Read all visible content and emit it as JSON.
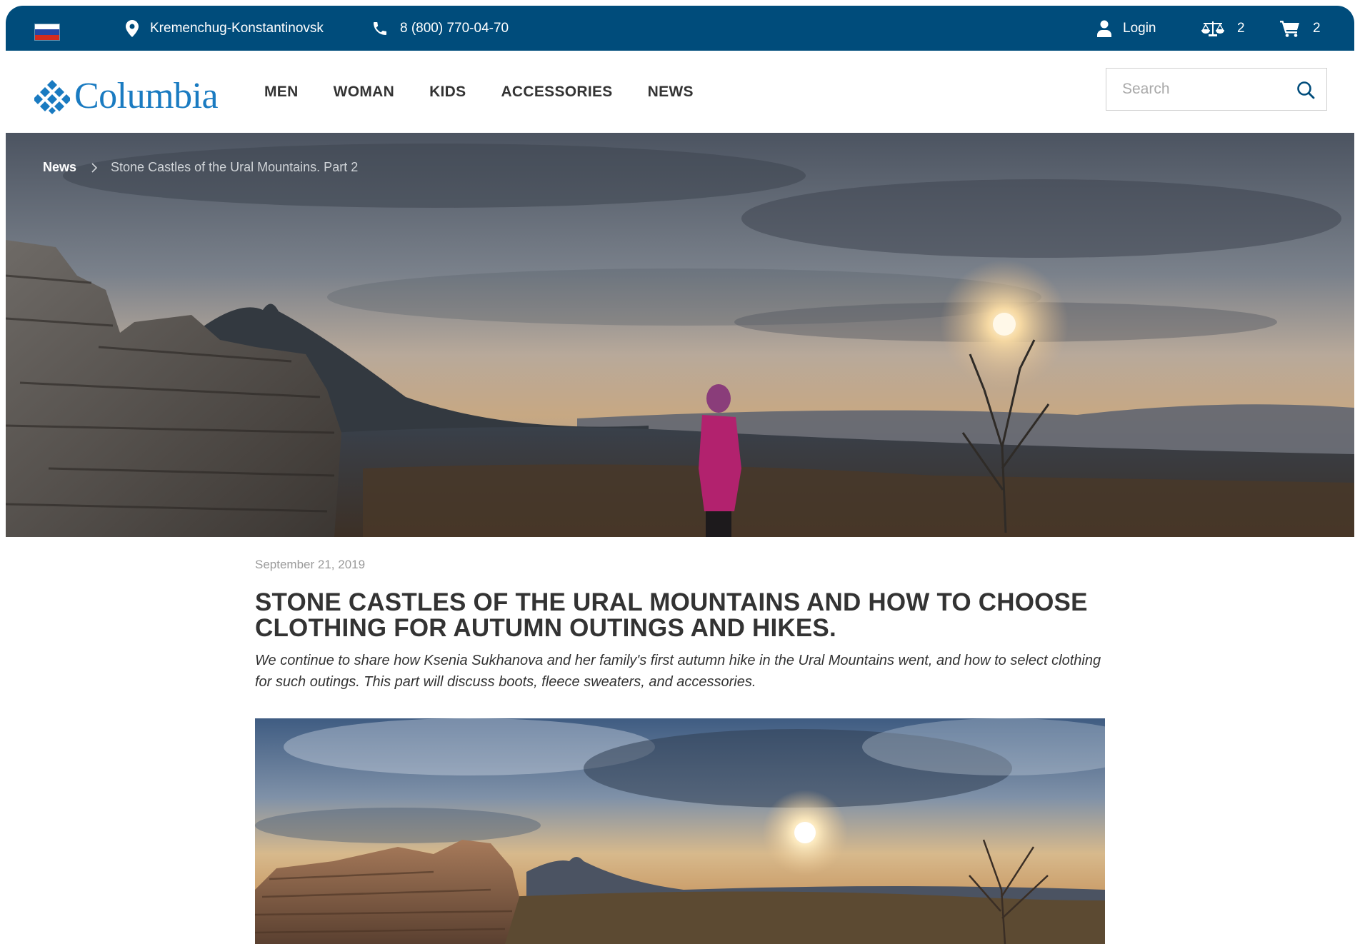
{
  "topbar": {
    "flag": "russia-flag",
    "location": "Kremenchug-Konstantinovsk",
    "phone": "8 (800) 770-04-70",
    "login": "Login",
    "compare_count": "2",
    "cart_count": "2"
  },
  "header": {
    "logo_text": "Columbia",
    "nav": [
      "MEN",
      "WOMAN",
      "KIDS",
      "ACCESSORIES",
      "NEWS"
    ],
    "search_placeholder": "Search"
  },
  "hero": {
    "breadcrumb": {
      "link": "News",
      "current": "Stone Castles of the Ural Mountains. Part 2"
    }
  },
  "article": {
    "date": "September 21, 2019",
    "title": "Stone castles of the Ural Mountains and how to choose clothing for autumn outings and hikes.",
    "lead": "We continue to share how Ksenia Sukhanova and her family's first autumn hike in the Ural Mountains went, and how to select clothing for such outings. This part will discuss boots, fleece sweaters, and accessories."
  },
  "colors": {
    "topbar_bg": "#004c7b",
    "brand_blue": "#1a7bc1",
    "text_dark": "#333333",
    "text_muted": "#9a9a9a"
  },
  "icons": {
    "location": "map-pin-icon",
    "phone": "phone-icon",
    "user": "user-icon",
    "compare": "scales-icon",
    "cart": "cart-icon",
    "search": "search-icon",
    "breadcrumb_separator": "chevron-right-icon"
  }
}
